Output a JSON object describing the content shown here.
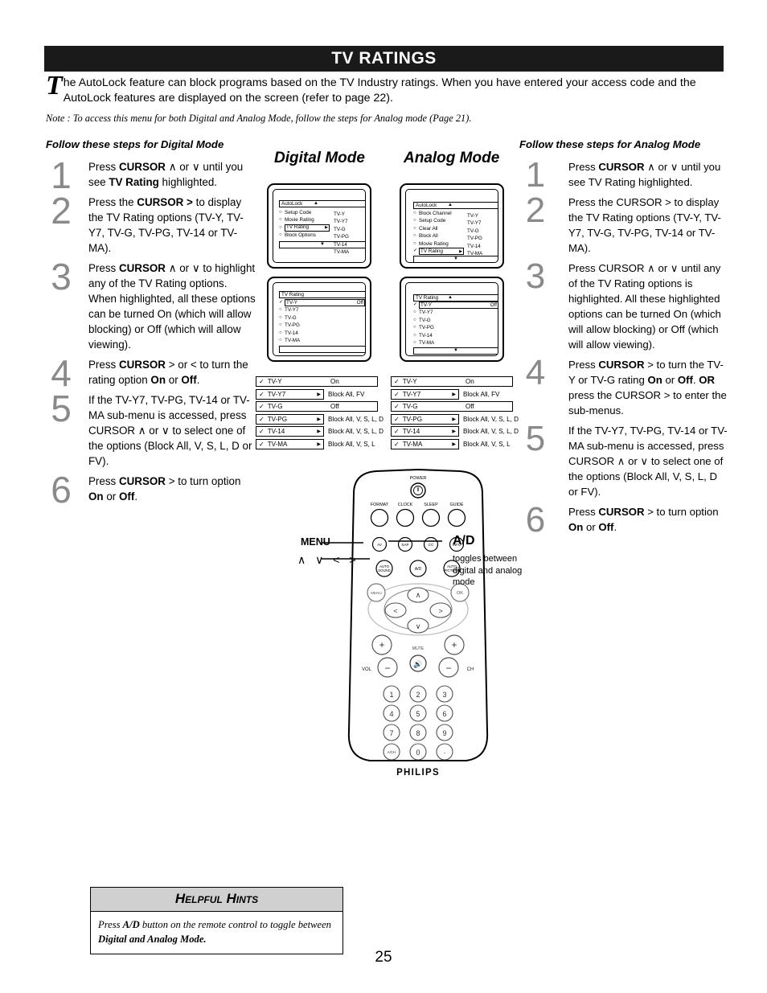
{
  "header": {
    "title": "TV RATINGS",
    "intro_dropcap": "T",
    "intro_text": "he AutoLock feature can block programs based on the TV Industry ratings.   When you have entered your access code and the AutoLock features are displayed on the screen (refer to page 22).",
    "note": "Note : To access this menu for both Digital and Analog Mode, follow the steps for Analog mode (Page 21)."
  },
  "columns": {
    "left_heading": "Follow these steps for Digital Mode",
    "right_heading": "Follow these steps for Analog Mode",
    "digital_mode_label": "Digital Mode",
    "analog_mode_label": "Analog Mode"
  },
  "digital_steps": [
    {
      "num": "1",
      "html": "Press <b>CURSOR</b> ∧  or ∨ until you see <b>TV Rating</b> highlighted."
    },
    {
      "num": "2",
      "html": "Press the <b>CURSOR  &gt;</b> to display the TV Rating options (TV-Y, TV-Y7, TV-G, TV-PG, TV-14 or TV-MA)."
    },
    {
      "num": "3",
      "html": "Press <b>CURSOR</b> ∧  or ∨ to highlight any of the TV Rating  options.  When highlighted, all these options can be turned On (which will allow blocking) or Off (which will allow viewing)."
    },
    {
      "num": "4",
      "html": "Press <b>CURSOR</b> &gt; or &lt;  to turn the rating option <b>On</b> or <b>Off</b>."
    },
    {
      "num": "5",
      "html": "If the TV-Y7, TV-PG, TV-14 or TV-MA sub-menu is accessed, press CURSOR ∧  or ∨ to select one of the options (Block All, V, S, L, D or FV)."
    },
    {
      "num": "6",
      "html": "Press <b>CURSOR</b> &gt;  to turn option <b>On</b> or <b>Off</b>."
    }
  ],
  "analog_steps": [
    {
      "num": "1",
      "html": "Press <b>CURSOR</b> ∧  or ∨ until you see TV Rating highlighted."
    },
    {
      "num": "2",
      "html": "Press the CURSOR  &gt; to display the TV Rating options (TV-Y, TV-Y7, TV-G, TV-PG, TV-14 or TV-MA)."
    },
    {
      "num": "3",
      "html": "Press CURSOR ∧  or ∨ until any of the TV Rating options is highlighted.  All these highlighted options can be turned On (which will allow blocking) or Off (which will allow viewing)."
    },
    {
      "num": "4",
      "html": "Press <b>CURSOR</b>  &gt;  to turn the TV-Y or TV-G rating <b>On</b> or <b>Off</b>. <b>OR</b> press the CURSOR &gt; to enter the sub-menus."
    },
    {
      "num": "5",
      "html": "If the TV-Y7, TV-PG, TV-14 or TV-MA sub-menu is accessed, press CURSOR ∧  or ∨  to select one of the options (Block All, V, S, L, D or FV)."
    },
    {
      "num": "6",
      "html": "Press <b>CURSOR</b> &gt;  to turn option <b>On</b> or <b>Off</b>."
    }
  ],
  "osd_digital_autolock": {
    "title": "AutoLock",
    "up_arrow": "▲",
    "down_arrow": "▼",
    "items": [
      {
        "label": "Setup Code",
        "selected": false
      },
      {
        "label": "Movie Rating",
        "selected": false
      },
      {
        "label": "TV Rating",
        "selected": true,
        "arrow": "▶"
      },
      {
        "label": "Block Options",
        "selected": false
      }
    ],
    "right_column": [
      "TV-Y",
      "TV-Y7",
      "TV-G",
      "TV-PG",
      "TV-14",
      "TV-MA"
    ]
  },
  "osd_analog_autolock": {
    "title": "AutoLock",
    "up_arrow": "▲",
    "down_arrow": "▼",
    "items": [
      {
        "label": "Block Channel",
        "selected": false
      },
      {
        "label": "Setup Code",
        "selected": false
      },
      {
        "label": "Clear All",
        "selected": false
      },
      {
        "label": "Block All",
        "selected": false
      },
      {
        "label": "Movie Rating",
        "selected": false
      },
      {
        "label": "TV Rating",
        "selected": true,
        "arrow": "▶",
        "check": "✓"
      }
    ],
    "right_column": [
      "TV-Y",
      "TV-Y7",
      "TV-G",
      "TV-PG",
      "TV-14",
      "TV-MA"
    ]
  },
  "osd_digital_tvrating": {
    "title": "TV Rating",
    "items": [
      {
        "label": "TV-Y",
        "selected": true,
        "check": "✓",
        "value": "Off"
      },
      {
        "label": "TV-Y7",
        "selected": false
      },
      {
        "label": "TV-G",
        "selected": false
      },
      {
        "label": "TV-PG",
        "selected": false
      },
      {
        "label": "TV-14",
        "selected": false
      },
      {
        "label": "TV-MA",
        "selected": false
      }
    ]
  },
  "osd_analog_tvrating": {
    "title": "TV Rating",
    "up_arrow": "▲",
    "down_arrow": "▼",
    "items": [
      {
        "label": "TV-Y",
        "selected": true,
        "check": "✓",
        "value": "Off"
      },
      {
        "label": "TV-Y7",
        "selected": false
      },
      {
        "label": "TV-G",
        "selected": false
      },
      {
        "label": "TV-PG",
        "selected": false
      },
      {
        "label": "TV-14",
        "selected": false
      },
      {
        "label": "TV-MA",
        "selected": false
      }
    ]
  },
  "rating_rows": [
    {
      "check": "✓",
      "name": "TV-Y",
      "arrow": "",
      "value": "On",
      "inside": true
    },
    {
      "check": "✓",
      "name": "TV-Y7",
      "arrow": "▶",
      "value": "Block All, FV",
      "inside": false
    },
    {
      "check": "✓",
      "name": "TV-G",
      "arrow": "",
      "value": "Off",
      "inside": true
    },
    {
      "check": "✓",
      "name": "TV-PG",
      "arrow": "▶",
      "value": "Block All, V, S, L, D",
      "inside": false
    },
    {
      "check": "✓",
      "name": "TV-14",
      "arrow": "▶",
      "value": "Block All, V, S, L, D",
      "inside": false
    },
    {
      "check": "✓",
      "name": "TV-MA",
      "arrow": "▶",
      "value": "Block All, V, S, L",
      "inside": false
    }
  ],
  "remote": {
    "power_label": "POWER",
    "row1": [
      "FORMAT",
      "CLOCK",
      "SLEEP",
      "GUIDE"
    ],
    "row2": [
      "AV",
      "SAP",
      "CC",
      "INFO"
    ],
    "row3": [
      "AUTO SOUND",
      "A/D",
      "AUTO PICTURE"
    ],
    "menu_button": "MENU",
    "ok_button": "OK",
    "mute_label": "MUTE",
    "vol_label": "VOL",
    "ch_label": "CH",
    "keypad": [
      "1",
      "2",
      "3",
      "4",
      "5",
      "6",
      "7",
      "8",
      "9",
      "A/CH",
      "0",
      "·"
    ],
    "brand": "PHILIPS"
  },
  "callouts": {
    "menu_label": "MENU",
    "cursor_glyphs": "∧ ∨ < >",
    "ad_label": "A/D",
    "ad_desc": "toggles between digital and analog mode"
  },
  "hints": {
    "heading": "Helpful Hints",
    "body_html": "Press <b>A/D</b> button on the remote control to toggle between <b>Digital and Analog Mode.</b>"
  },
  "page_number": "25"
}
